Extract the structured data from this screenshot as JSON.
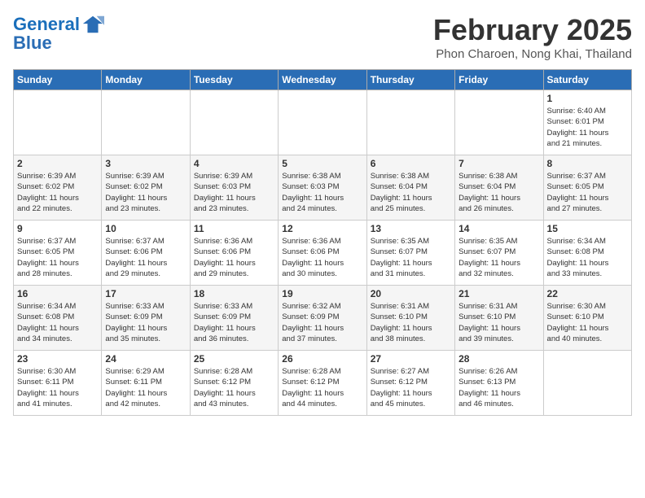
{
  "header": {
    "logo_line1": "General",
    "logo_line2": "Blue",
    "month": "February 2025",
    "location": "Phon Charoen, Nong Khai, Thailand"
  },
  "weekdays": [
    "Sunday",
    "Monday",
    "Tuesday",
    "Wednesday",
    "Thursday",
    "Friday",
    "Saturday"
  ],
  "weeks": [
    [
      {
        "day": "",
        "info": ""
      },
      {
        "day": "",
        "info": ""
      },
      {
        "day": "",
        "info": ""
      },
      {
        "day": "",
        "info": ""
      },
      {
        "day": "",
        "info": ""
      },
      {
        "day": "",
        "info": ""
      },
      {
        "day": "1",
        "info": "Sunrise: 6:40 AM\nSunset: 6:01 PM\nDaylight: 11 hours\nand 21 minutes."
      }
    ],
    [
      {
        "day": "2",
        "info": "Sunrise: 6:39 AM\nSunset: 6:02 PM\nDaylight: 11 hours\nand 22 minutes."
      },
      {
        "day": "3",
        "info": "Sunrise: 6:39 AM\nSunset: 6:02 PM\nDaylight: 11 hours\nand 23 minutes."
      },
      {
        "day": "4",
        "info": "Sunrise: 6:39 AM\nSunset: 6:03 PM\nDaylight: 11 hours\nand 23 minutes."
      },
      {
        "day": "5",
        "info": "Sunrise: 6:38 AM\nSunset: 6:03 PM\nDaylight: 11 hours\nand 24 minutes."
      },
      {
        "day": "6",
        "info": "Sunrise: 6:38 AM\nSunset: 6:04 PM\nDaylight: 11 hours\nand 25 minutes."
      },
      {
        "day": "7",
        "info": "Sunrise: 6:38 AM\nSunset: 6:04 PM\nDaylight: 11 hours\nand 26 minutes."
      },
      {
        "day": "8",
        "info": "Sunrise: 6:37 AM\nSunset: 6:05 PM\nDaylight: 11 hours\nand 27 minutes."
      }
    ],
    [
      {
        "day": "9",
        "info": "Sunrise: 6:37 AM\nSunset: 6:05 PM\nDaylight: 11 hours\nand 28 minutes."
      },
      {
        "day": "10",
        "info": "Sunrise: 6:37 AM\nSunset: 6:06 PM\nDaylight: 11 hours\nand 29 minutes."
      },
      {
        "day": "11",
        "info": "Sunrise: 6:36 AM\nSunset: 6:06 PM\nDaylight: 11 hours\nand 29 minutes."
      },
      {
        "day": "12",
        "info": "Sunrise: 6:36 AM\nSunset: 6:06 PM\nDaylight: 11 hours\nand 30 minutes."
      },
      {
        "day": "13",
        "info": "Sunrise: 6:35 AM\nSunset: 6:07 PM\nDaylight: 11 hours\nand 31 minutes."
      },
      {
        "day": "14",
        "info": "Sunrise: 6:35 AM\nSunset: 6:07 PM\nDaylight: 11 hours\nand 32 minutes."
      },
      {
        "day": "15",
        "info": "Sunrise: 6:34 AM\nSunset: 6:08 PM\nDaylight: 11 hours\nand 33 minutes."
      }
    ],
    [
      {
        "day": "16",
        "info": "Sunrise: 6:34 AM\nSunset: 6:08 PM\nDaylight: 11 hours\nand 34 minutes."
      },
      {
        "day": "17",
        "info": "Sunrise: 6:33 AM\nSunset: 6:09 PM\nDaylight: 11 hours\nand 35 minutes."
      },
      {
        "day": "18",
        "info": "Sunrise: 6:33 AM\nSunset: 6:09 PM\nDaylight: 11 hours\nand 36 minutes."
      },
      {
        "day": "19",
        "info": "Sunrise: 6:32 AM\nSunset: 6:09 PM\nDaylight: 11 hours\nand 37 minutes."
      },
      {
        "day": "20",
        "info": "Sunrise: 6:31 AM\nSunset: 6:10 PM\nDaylight: 11 hours\nand 38 minutes."
      },
      {
        "day": "21",
        "info": "Sunrise: 6:31 AM\nSunset: 6:10 PM\nDaylight: 11 hours\nand 39 minutes."
      },
      {
        "day": "22",
        "info": "Sunrise: 6:30 AM\nSunset: 6:10 PM\nDaylight: 11 hours\nand 40 minutes."
      }
    ],
    [
      {
        "day": "23",
        "info": "Sunrise: 6:30 AM\nSunset: 6:11 PM\nDaylight: 11 hours\nand 41 minutes."
      },
      {
        "day": "24",
        "info": "Sunrise: 6:29 AM\nSunset: 6:11 PM\nDaylight: 11 hours\nand 42 minutes."
      },
      {
        "day": "25",
        "info": "Sunrise: 6:28 AM\nSunset: 6:12 PM\nDaylight: 11 hours\nand 43 minutes."
      },
      {
        "day": "26",
        "info": "Sunrise: 6:28 AM\nSunset: 6:12 PM\nDaylight: 11 hours\nand 44 minutes."
      },
      {
        "day": "27",
        "info": "Sunrise: 6:27 AM\nSunset: 6:12 PM\nDaylight: 11 hours\nand 45 minutes."
      },
      {
        "day": "28",
        "info": "Sunrise: 6:26 AM\nSunset: 6:13 PM\nDaylight: 11 hours\nand 46 minutes."
      },
      {
        "day": "",
        "info": ""
      }
    ]
  ]
}
